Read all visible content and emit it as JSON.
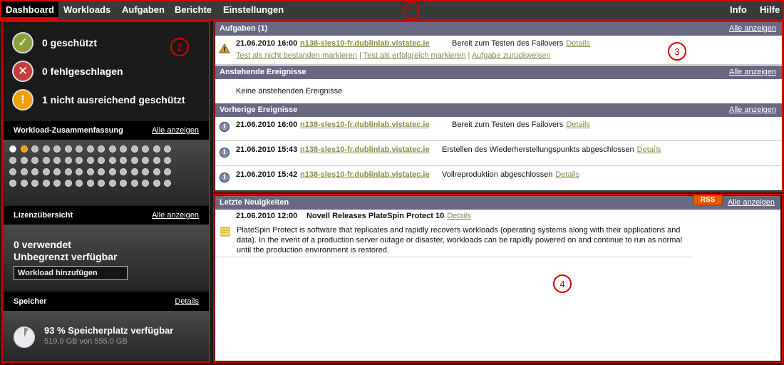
{
  "nav": {
    "items": [
      {
        "label": "Dashboard",
        "active": true
      },
      {
        "label": "Workloads"
      },
      {
        "label": "Aufgaben"
      },
      {
        "label": "Berichte"
      },
      {
        "label": "Einstellungen"
      }
    ],
    "right": [
      {
        "label": "Info"
      },
      {
        "label": "Hilfe"
      }
    ]
  },
  "callouts": [
    "1",
    "2",
    "3",
    "4"
  ],
  "status": {
    "protected": "0 geschützt",
    "failed": "0 fehlgeschlagen",
    "underprotected": "1 nicht ausreichend geschützt"
  },
  "workload_summary": {
    "title": "Workload-Zusammenfassung",
    "link": "Alle anzeigen",
    "dot_states": [
      "ok",
      "warn"
    ]
  },
  "license": {
    "title": "Lizenzübersicht",
    "link": "Alle anzeigen",
    "used": "0 verwendet",
    "available": "Unbegrenzt verfügbar",
    "add_button": "Workload hinzufügen"
  },
  "storage": {
    "title": "Speicher",
    "link": "Details",
    "free_text": "93 % Speicherplatz verfügbar",
    "detail": "519,9 GB von 555,0 GB",
    "free_fraction": 0.93
  },
  "tasks": {
    "title": "Aufgaben (1)",
    "link": "Alle anzeigen",
    "item": {
      "date": "21.06.2010 16:00",
      "host": "n138-sles10-fr.dublinlab.vistatec.ie",
      "message": "Bereit zum Testen des Failovers",
      "details": "Details",
      "actions": [
        "Test als nicht bestanden markieren",
        "Test als erfolgreich markieren",
        "Aufgabe zurückweisen"
      ]
    }
  },
  "upcoming": {
    "title": "Anstehende Ereignisse",
    "link": "Alle anzeigen",
    "empty": "Keine anstehenden Ereignisse"
  },
  "previous": {
    "title": "Vorherige Ereignisse",
    "link": "Alle anzeigen",
    "items": [
      {
        "date": "21.06.2010 16:00",
        "host": "n138-sles10-fr.dublinlab.vistatec.ie",
        "message": "Bereit zum Testen des Failovers",
        "details": "Details"
      },
      {
        "date": "21.06.2010 15:43",
        "host": "n138-sles10-fr.dublinlab.vistatec.ie",
        "message": "Erstellen des Wiederherstellungspunkts abgeschlossen",
        "details": "Details"
      },
      {
        "date": "21.06.2010 15:42",
        "host": "n138-sles10-fr.dublinlab.vistatec.ie",
        "message": "Vollreproduktion abgeschlossen",
        "details": "Details"
      }
    ]
  },
  "news": {
    "title": "Letzte Neuigkeiten",
    "rss": "RSS",
    "link": "Alle anzeigen",
    "item": {
      "date": "21.06.2010 12:00",
      "headline": "Novell Releases PlateSpin Protect 10",
      "details": "Details",
      "body": "PlateSpin Protect is software that replicates and rapidly recovers workloads (operating systems along with their applications and data). In the event of a production server outage or disaster, workloads can be rapidly powered on and continue to run as normal until the production environment is restored."
    }
  }
}
